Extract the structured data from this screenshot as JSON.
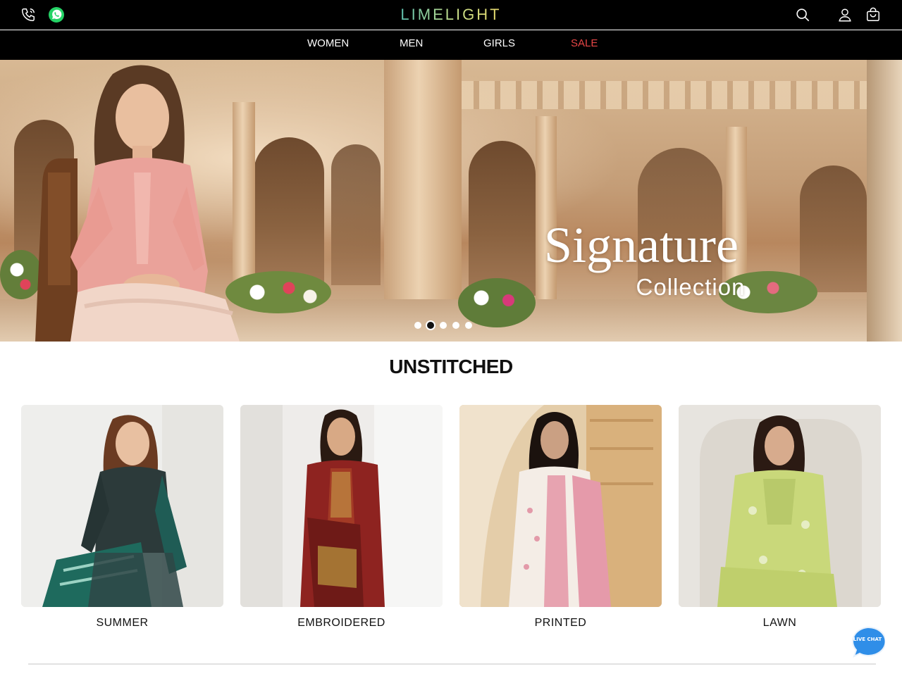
{
  "header": {
    "logo": "LIMELIGHT",
    "icons": [
      "phone-icon",
      "whatsapp-icon",
      "search-icon",
      "user-icon",
      "bag-icon"
    ]
  },
  "nav": {
    "items": [
      {
        "label": "WOMEN"
      },
      {
        "label": "MEN"
      },
      {
        "label": "GIRLS"
      },
      {
        "label": "SALE",
        "color": "#e64646"
      }
    ]
  },
  "hero": {
    "title": "Signature",
    "subtitle": "Collection",
    "slides": 5,
    "active_slide": 1
  },
  "section": {
    "title": "UNSTITCHED",
    "categories": [
      {
        "label": "SUMMER"
      },
      {
        "label": "EMBROIDERED"
      },
      {
        "label": "PRINTED"
      },
      {
        "label": "LAWN"
      }
    ]
  },
  "chat": {
    "label": "LIVE CHAT",
    "color": "#2f8ee8"
  },
  "colors": {
    "header_bg": "#000000",
    "sale": "#e64646",
    "logo_gradient": [
      "#5fc2b0",
      "#c9df89",
      "#e7d86b"
    ]
  }
}
